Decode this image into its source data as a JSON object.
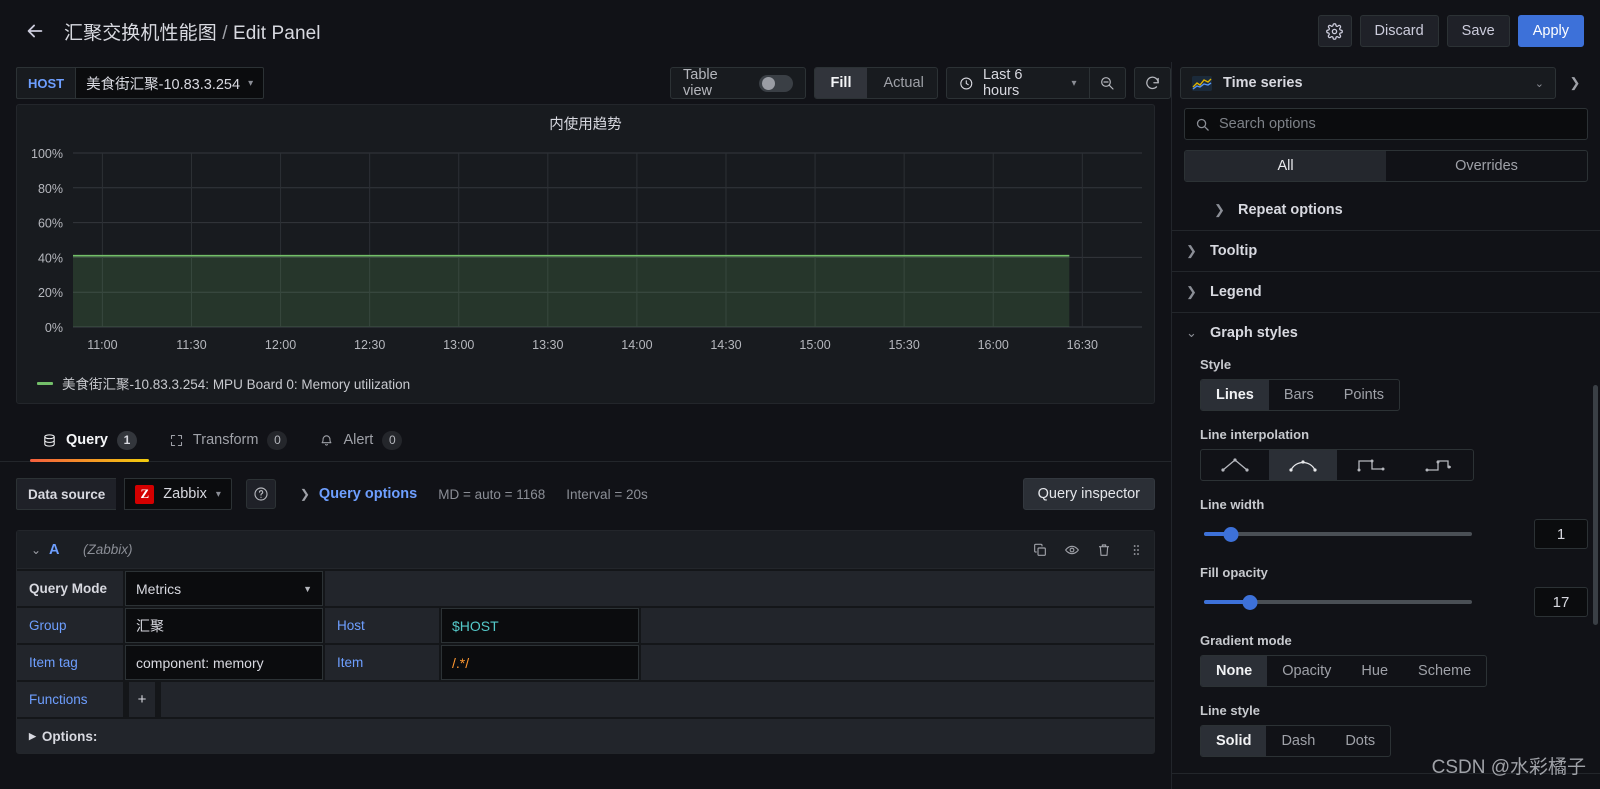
{
  "header": {
    "back_icon": "arrow-left-icon",
    "dashboard_title": "汇聚交换机性能图",
    "separator": "/",
    "page_title": "Edit Panel",
    "settings_icon": "gear-icon",
    "discard_label": "Discard",
    "save_label": "Save",
    "apply_label": "Apply",
    "accent_color": "#3d71d9"
  },
  "toolbar": {
    "variable": {
      "label": "HOST",
      "value": "美食街汇聚-10.83.3.254",
      "chevron_icon": "chevron-down-icon"
    },
    "table_view": {
      "label": "Table view",
      "enabled": false
    },
    "fill_actual": {
      "options": [
        "Fill",
        "Actual"
      ],
      "selected": "Fill"
    },
    "time_picker": {
      "clock_icon": "clock-icon",
      "value": "Last 6 hours",
      "chevron_icon": "chevron-down-icon"
    },
    "zoom_out_icon": "zoom-out-icon",
    "refresh_icon": "refresh-icon"
  },
  "panel": {
    "title": "内使用趋势",
    "legend": {
      "color": "#73bf69",
      "label": "美食街汇聚-10.83.3.254: MPU Board 0: Memory utilization"
    }
  },
  "chart_data": {
    "type": "area",
    "title": "内使用趋势",
    "xlabel": "",
    "ylabel": "",
    "ylim": [
      0,
      100
    ],
    "ytick_labels": [
      "0%",
      "20%",
      "40%",
      "60%",
      "80%",
      "100%"
    ],
    "ytick_values": [
      0,
      20,
      40,
      60,
      80,
      100
    ],
    "xtick_labels": [
      "11:00",
      "11:30",
      "12:00",
      "12:30",
      "13:00",
      "13:30",
      "14:00",
      "14:30",
      "15:00",
      "15:30",
      "16:00",
      "16:30"
    ],
    "grid": true,
    "legend_position": "bottom-left",
    "series": [
      {
        "name": "美食街汇聚-10.83.3.254: MPU Board 0: Memory utilization",
        "color": "#73bf69",
        "fill_opacity": 17,
        "unit": "percent",
        "values": [
          41,
          41,
          41,
          41,
          41,
          41,
          41,
          41,
          41,
          41,
          41,
          41,
          41,
          41,
          41,
          41,
          41,
          41,
          41,
          41,
          41,
          41,
          41,
          41
        ]
      }
    ]
  },
  "tabs": [
    {
      "label": "Query",
      "count": "1",
      "icon": "database-icon",
      "active": true
    },
    {
      "label": "Transform",
      "count": "0",
      "icon": "transform-icon",
      "active": false
    },
    {
      "label": "Alert",
      "count": "0",
      "icon": "bell-icon",
      "active": false
    }
  ],
  "query_pane": {
    "data_source_label": "Data source",
    "data_source_value": "Zabbix",
    "data_source_logo": "Z",
    "help_icon": "question-circle-icon",
    "query_options_label": "Query options",
    "query_options_meta_md": "MD = auto = 1168",
    "query_options_meta_interval": "Interval = 20s",
    "query_inspector_label": "Query inspector",
    "query": {
      "ref_id": "A",
      "data_source": "(Zabbix)",
      "actions": [
        "duplicate-icon",
        "eye-icon",
        "trash-icon",
        "drag-handle-icon"
      ],
      "rows": [
        {
          "label": "Query Mode",
          "value": "Metrics",
          "type": "select"
        },
        {
          "label": "Group",
          "value": "汇聚",
          "label2": "Host",
          "value2": "$HOST",
          "value2_style": "variable"
        },
        {
          "label": "Item tag",
          "value": "component: memory",
          "label2": "Item",
          "value2": "/.*/",
          "value2_style": "regex"
        },
        {
          "label": "Functions",
          "value": "+",
          "type": "add"
        }
      ],
      "options_label": "Options:"
    }
  },
  "options_pane": {
    "viz_picker": {
      "name": "Time series",
      "icon": "time-series-icon",
      "chevron_icon": "chevron-down-icon",
      "collapse_icon": "chevron-right-icon"
    },
    "search": {
      "icon": "search-icon",
      "placeholder": "Search options",
      "value": ""
    },
    "all_overrides": {
      "options": [
        "All",
        "Overrides"
      ],
      "selected": "All"
    },
    "groups": [
      {
        "title": "Repeat options",
        "expanded": false,
        "indent": true
      },
      {
        "title": "Tooltip",
        "expanded": false,
        "indent": false
      },
      {
        "title": "Legend",
        "expanded": false,
        "indent": false
      },
      {
        "title": "Graph styles",
        "expanded": true,
        "indent": false
      }
    ],
    "graph_styles": {
      "style": {
        "label": "Style",
        "options": [
          "Lines",
          "Bars",
          "Points"
        ],
        "selected": "Lines"
      },
      "line_interpolation": {
        "label": "Line interpolation",
        "options": [
          "linear-icon",
          "smooth-icon",
          "step-before-icon",
          "step-after-icon"
        ],
        "selected_index": 1
      },
      "line_width": {
        "label": "Line width",
        "value": "1",
        "min": 0,
        "max": 10
      },
      "fill_opacity": {
        "label": "Fill opacity",
        "value": "17",
        "min": 0,
        "max": 100
      },
      "gradient_mode": {
        "label": "Gradient mode",
        "options": [
          "None",
          "Opacity",
          "Hue",
          "Scheme"
        ],
        "selected": "None"
      },
      "line_style": {
        "label": "Line style",
        "options": [
          "Solid",
          "Dash",
          "Dots"
        ],
        "selected": "Solid"
      }
    }
  },
  "watermark": "CSDN @水彩橘子"
}
